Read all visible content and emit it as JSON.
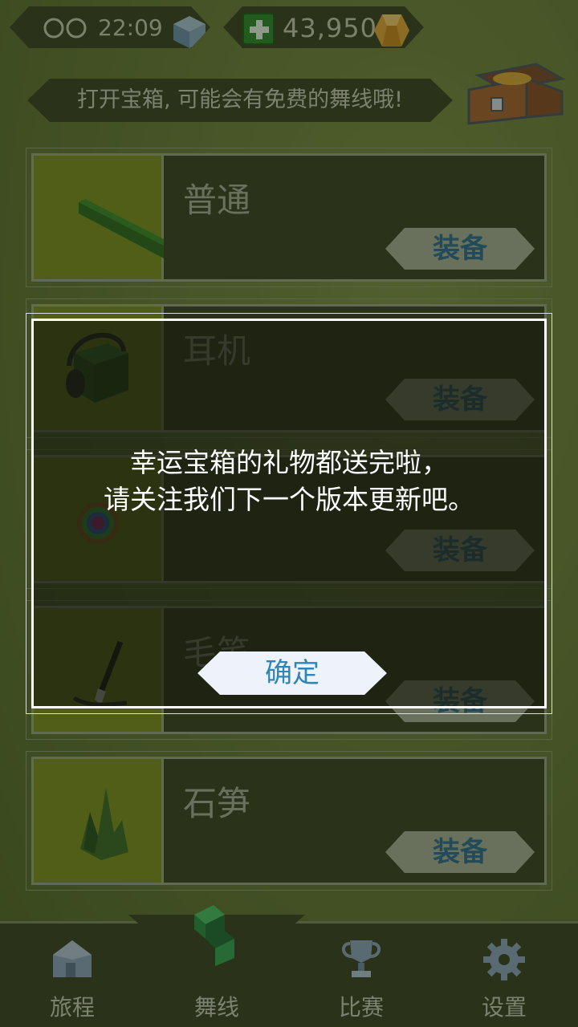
{
  "status": {
    "timer": "22:09",
    "gems": "43,950"
  },
  "hint_banner": "打开宝箱, 可能会有免费的舞线哦!",
  "skins": [
    {
      "name": "普通",
      "equip_label": "装备"
    },
    {
      "name": "耳机",
      "equip_label": "装备"
    },
    {
      "name": "",
      "equip_label": "装备"
    },
    {
      "name": "毛笔",
      "equip_label": "装备"
    },
    {
      "name": "石笋",
      "equip_label": "装备"
    }
  ],
  "nav": {
    "journey": "旅程",
    "dance_line": "舞线",
    "race": "比赛",
    "settings": "设置"
  },
  "modal": {
    "line1": "幸运宝箱的礼物都送完啦，",
    "line2": "请关注我们下一个版本更新吧。",
    "confirm_label": "确定"
  },
  "colors": {
    "background": "#687a3a",
    "panel": "#3c4627",
    "thumb": "#7d8f22",
    "equip_text": "#2f6f8f",
    "confirm_text": "#2f86b6"
  }
}
